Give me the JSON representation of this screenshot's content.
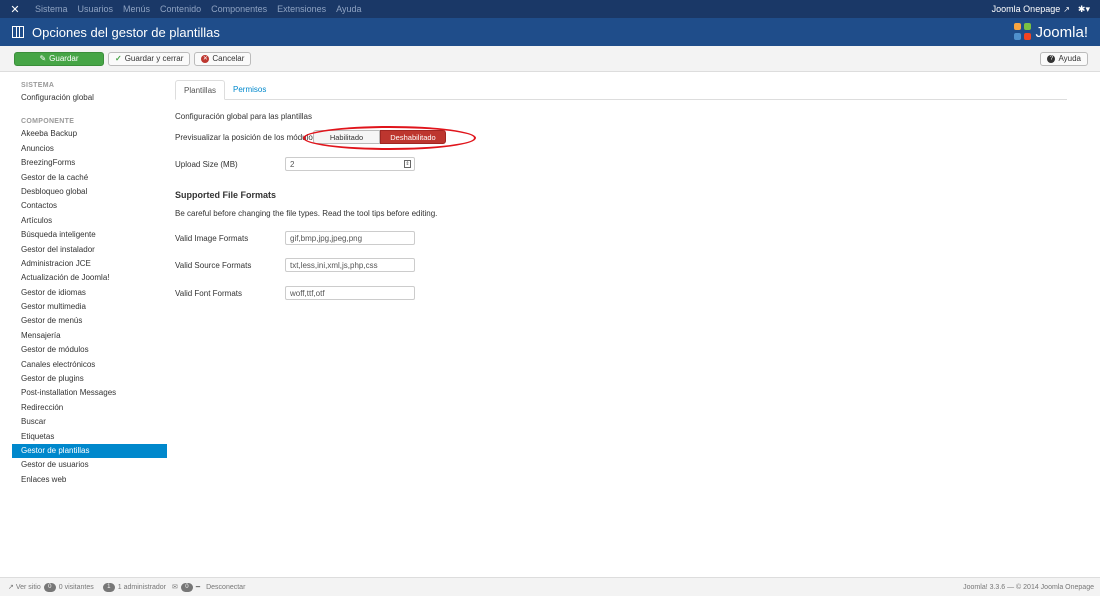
{
  "topnav": {
    "menu": [
      "Sistema",
      "Usuarios",
      "Menús",
      "Contenido",
      "Componentes",
      "Extensiones",
      "Ayuda"
    ],
    "site_link": "Joomla Onepage",
    "settings_caret": "▾"
  },
  "header": {
    "title": "Opciones del gestor de plantillas",
    "brand": "Joomla!"
  },
  "toolbar": {
    "save_label": "Guardar",
    "save_close_label": "Guardar y cerrar",
    "cancel_label": "Cancelar",
    "help_label": "Ayuda"
  },
  "sidebar": {
    "system_heading": "SISTEMA",
    "system_items": [
      "Configuración global"
    ],
    "component_heading": "COMPONENTE",
    "component_items": [
      "Akeeba Backup",
      "Anuncios",
      "BreezingForms",
      "Gestor de la caché",
      "Desbloqueo global",
      "Contactos",
      "Artículos",
      "Búsqueda inteligente",
      "Gestor del instalador",
      "Administracion JCE",
      "Actualización de Joomla!",
      "Gestor de idiomas",
      "Gestor multimedia",
      "Gestor de menús",
      "Mensajería",
      "Gestor de módulos",
      "Canales electrónicos",
      "Gestor de plugins",
      "Post-installation Messages",
      "Redirección",
      "Buscar",
      "Etiquetas",
      "Gestor de plantillas",
      "Gestor de usuarios",
      "Enlaces web"
    ],
    "active_item": "Gestor de plantillas"
  },
  "tabs": [
    "Plantillas",
    "Permisos"
  ],
  "form": {
    "intro": "Configuración global para las plantillas",
    "preview_label": "Previsualizar la posición de los módulos",
    "toggle_enabled": "Habilitado",
    "toggle_disabled": "Deshabilitado",
    "toggle_selected": "Deshabilitado",
    "upload_label": "Upload Size (MB)",
    "upload_value": "2",
    "formats_heading": "Supported File Formats",
    "formats_note": "Be careful before changing the file types. Read the tool tips before editing.",
    "image_label": "Valid Image Formats",
    "image_value": "gif,bmp,jpg,jpeg,png",
    "source_label": "Valid Source Formats",
    "source_value": "txt,less,ini,xml,js,php,css",
    "font_label": "Valid Font Formats",
    "font_value": "woff,ttf,otf"
  },
  "footer": {
    "view_site": "Ver sitio",
    "visitors_count": "0",
    "visitors_label": "0 visitantes",
    "admins_count": "1",
    "admins_label": "1 administrador",
    "messages_count": "0",
    "logout": "Desconectar",
    "version": "Joomla! 3.3.6 — © 2014 Joomla Onepage"
  },
  "colors": {
    "topnav_bg": "#1a3867",
    "header_bg": "#1f4d8a",
    "save_green": "#46a546",
    "active_blue": "#0088cc",
    "toggle_red": "#bd362f",
    "annotation_red": "#e0141b"
  }
}
